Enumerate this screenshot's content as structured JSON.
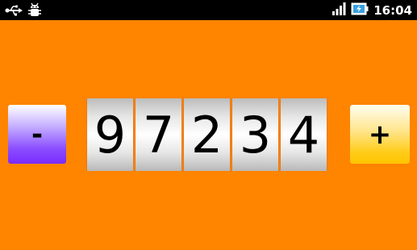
{
  "status_bar": {
    "time": "16:04",
    "left_icons": [
      "usb-icon",
      "debug-bug-icon"
    ],
    "right_icons": [
      "signal-icon",
      "battery-charging-icon"
    ]
  },
  "counter": {
    "digits": [
      "9",
      "7",
      "2",
      "3",
      "4"
    ],
    "decrement_label": "-",
    "increment_label": "+"
  },
  "colors": {
    "background": "#ff8400",
    "minus_button": "#7a2bff",
    "plus_button": "#ffcc1a"
  }
}
